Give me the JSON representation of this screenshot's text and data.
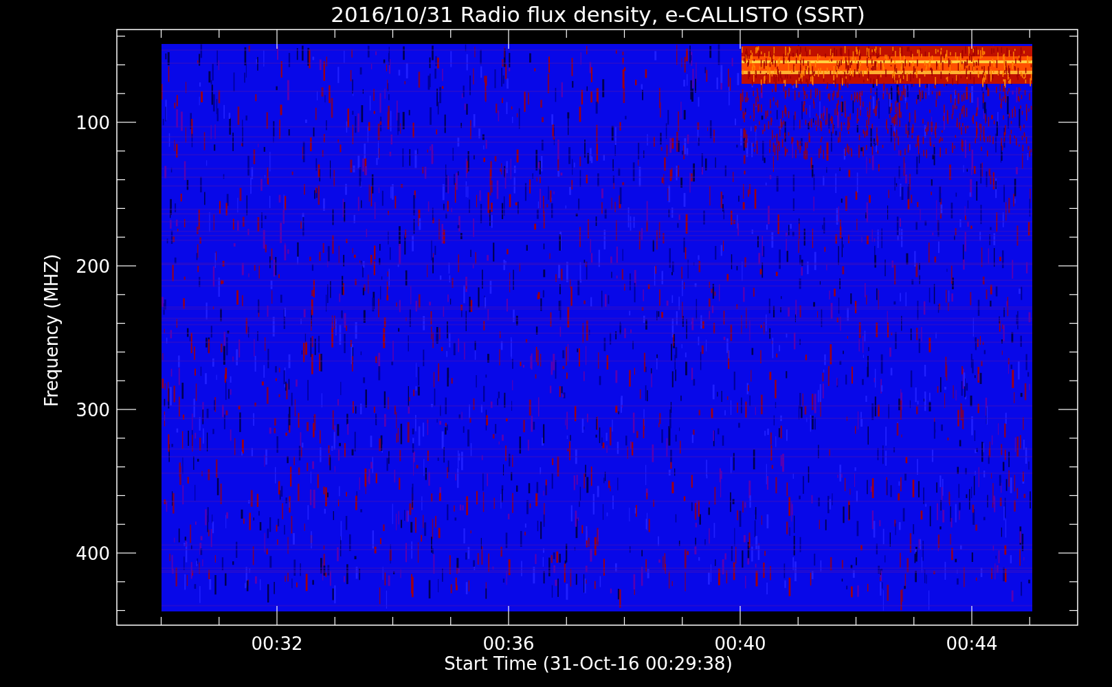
{
  "title": "2016/10/31  Radio flux density, e-CALLISTO (SSRT)",
  "y_axis": {
    "label": "Frequency (MHZ)",
    "ticks": [
      "100",
      "200",
      "300",
      "400"
    ]
  },
  "x_axis": {
    "label": "Start Time (31-Oct-16 00:29:38)",
    "ticks": [
      "00:32",
      "00:36",
      "00:40",
      "00:44"
    ]
  }
}
